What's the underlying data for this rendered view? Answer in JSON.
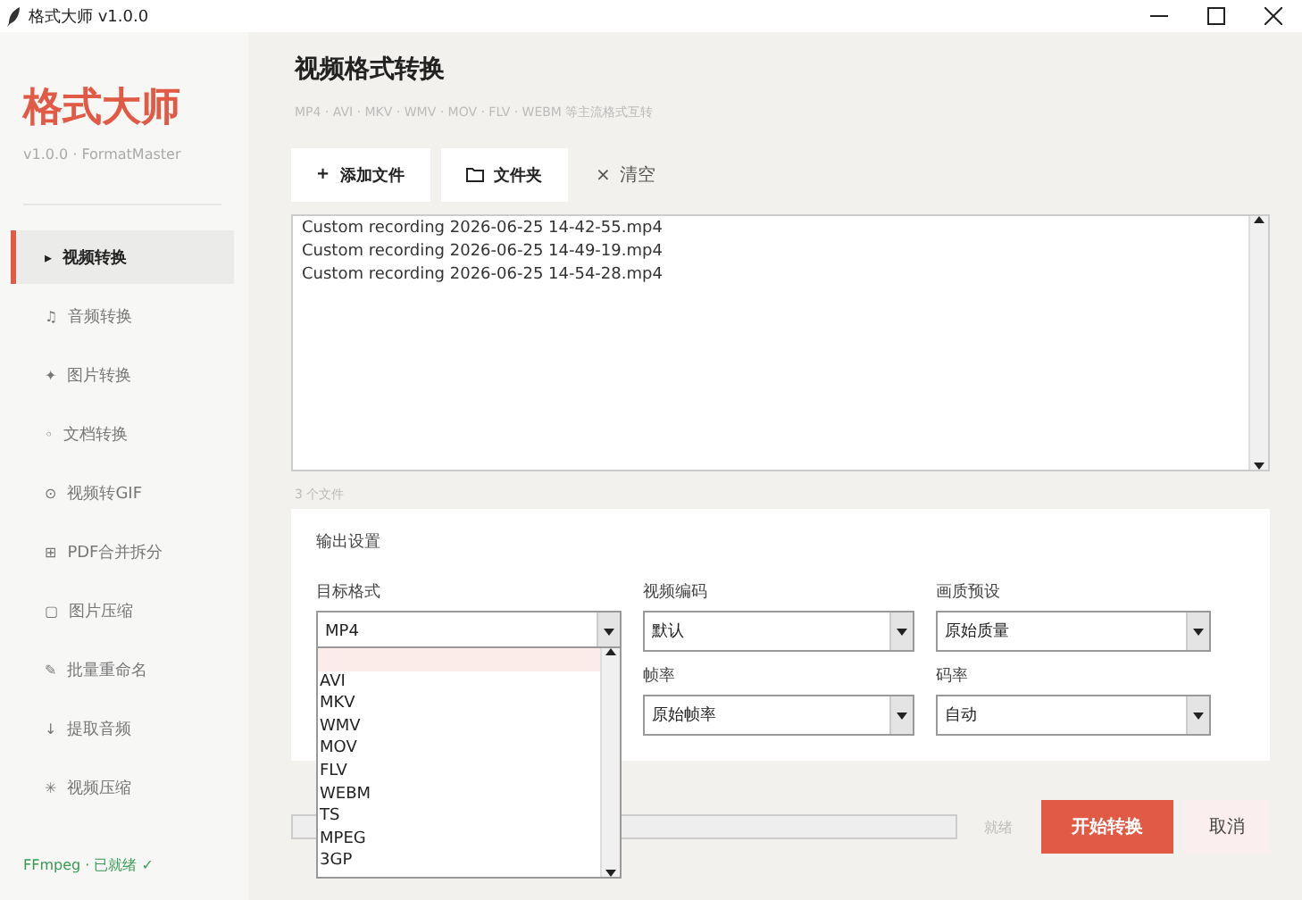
{
  "window": {
    "title": "格式大师 v1.0.0"
  },
  "sidebar": {
    "logo": "格式大师",
    "version": "v1.0.0 · FormatMaster",
    "items": [
      {
        "icon": "▸",
        "label": "视频转换",
        "selected": true
      },
      {
        "icon": "♫",
        "label": "音频转换",
        "selected": false
      },
      {
        "icon": "✦",
        "label": "图片转换",
        "selected": false
      },
      {
        "icon": "◦",
        "label": "文档转换",
        "selected": false
      },
      {
        "icon": "⊙",
        "label": "视频转GIF",
        "selected": false
      },
      {
        "icon": "⊞",
        "label": "PDF合并拆分",
        "selected": false
      },
      {
        "icon": "▢",
        "label": "图片压缩",
        "selected": false
      },
      {
        "icon": "✎",
        "label": "批量重命名",
        "selected": false
      },
      {
        "icon": "↓",
        "label": "提取音频",
        "selected": false
      },
      {
        "icon": "✳",
        "label": "视频压缩",
        "selected": false
      }
    ],
    "status": "FFmpeg · 已就绪 ✓"
  },
  "page": {
    "title": "视频格式转换",
    "subtitle": "MP4 · AVI · MKV · WMV · MOV · FLV · WEBM 等主流格式互转"
  },
  "toolbar": [
    {
      "icon": "+",
      "label": "添加文件",
      "kind": "button"
    },
    {
      "label": "文件夹",
      "kind": "folder"
    },
    {
      "icon": "×",
      "label": "清空",
      "kind": "link"
    }
  ],
  "files": [
    "Custom recording 2026-06-25 14-42-55.mp4",
    "Custom recording 2026-06-25 14-49-19.mp4",
    "Custom recording 2026-06-25 14-54-28.mp4"
  ],
  "file_count": "3 个文件",
  "settings": {
    "title": "输出设置",
    "fields": [
      {
        "label": "目标格式",
        "value": "MP4"
      },
      {
        "label": "视频编码",
        "value": "默认"
      },
      {
        "label": "画质预设",
        "value": "原始质量"
      },
      {
        "label": "帧率",
        "value": "原始帧率"
      },
      {
        "label": "码率",
        "value": "自动"
      }
    ],
    "dropdown_options": [
      {
        "selected": true
      },
      {
        "label": "AVI",
        "selected": false
      },
      {
        "label": "MKV",
        "selected": false
      },
      {
        "label": "WMV",
        "selected": false
      },
      {
        "label": "MOV",
        "selected": false
      },
      {
        "label": "FLV",
        "selected": false
      },
      {
        "label": "WEBM",
        "selected": false
      },
      {
        "label": "TS",
        "selected": false
      },
      {
        "label": "MPEG",
        "selected": false
      },
      {
        "label": "3GP",
        "selected": false
      }
    ]
  },
  "progress": {
    "level": 0,
    "status": "就绪"
  },
  "actions": {
    "start": "开始转换",
    "cancel": "取消"
  }
}
